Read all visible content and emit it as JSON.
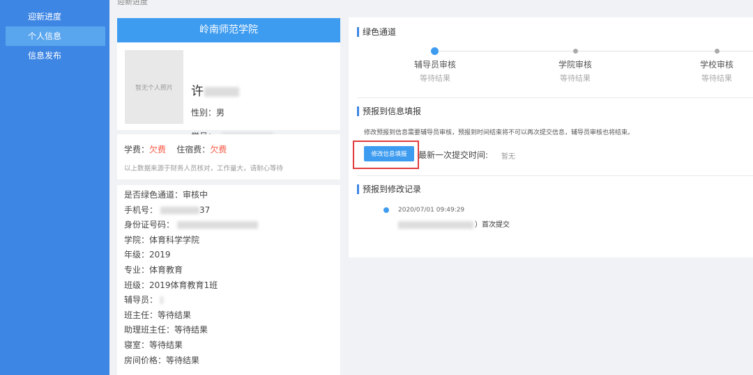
{
  "sidebar": {
    "items": [
      {
        "label": "迎新进度"
      },
      {
        "label": "个人信息"
      },
      {
        "label": "信息发布"
      }
    ]
  },
  "top_fragment": "迎新进度",
  "profile": {
    "school": "岭南师范学院",
    "photo_placeholder": "暂无个人照片",
    "name_visible": "许",
    "gender": "性别：男",
    "student_id_label": "学号："
  },
  "fees": {
    "tuition_label": "学费：",
    "tuition_value": "欠费",
    "dorm_label": "住宿费：",
    "dorm_value": "欠费",
    "note": "以上数据来源于财务人员核对，工作量大，请耐心等待"
  },
  "details": {
    "green_channel": "是否绿色通道：审核中",
    "phone_label": "手机号：",
    "phone_tail": "37",
    "id_label": "身份证号码：",
    "college": "学院：体育科学学院",
    "grade": "年级：2019",
    "major": "专业：体育教育",
    "class": "班级：2019体育教育1班",
    "counselor": "辅导员：",
    "head_teacher": "班主任：等待结果",
    "assistant_head_teacher": "助理班主任：等待结果",
    "dorm": "寝室：等待结果",
    "room_price": "房间价格：等待结果"
  },
  "green_channel": {
    "title": "绿色通道",
    "steps": [
      {
        "label": "辅导员审核",
        "status": "等待结果",
        "active": true
      },
      {
        "label": "学院审核",
        "status": "等待结果",
        "active": false
      },
      {
        "label": "学校审核",
        "status": "等待结果",
        "active": false
      }
    ]
  },
  "prereg": {
    "title": "预报到信息填报",
    "notice": "修改预报到信息需要辅导员审核，预报到时间结束将不可以再次提交信息，辅导员审核也将结束。",
    "edit_button": "修改信息填报",
    "last_submit_label": "最新一次提交时间:",
    "last_submit_value": "暂无"
  },
  "records": {
    "title": "预报到修改记录",
    "items": [
      {
        "time": "2020/07/01 09:49:29",
        "text": "）首次提交"
      }
    ]
  },
  "colors": {
    "sidebar": "#3e86e4",
    "header": "#3e9cf0",
    "debt": "#f5533d",
    "highlight_box": "#e23b3b"
  }
}
